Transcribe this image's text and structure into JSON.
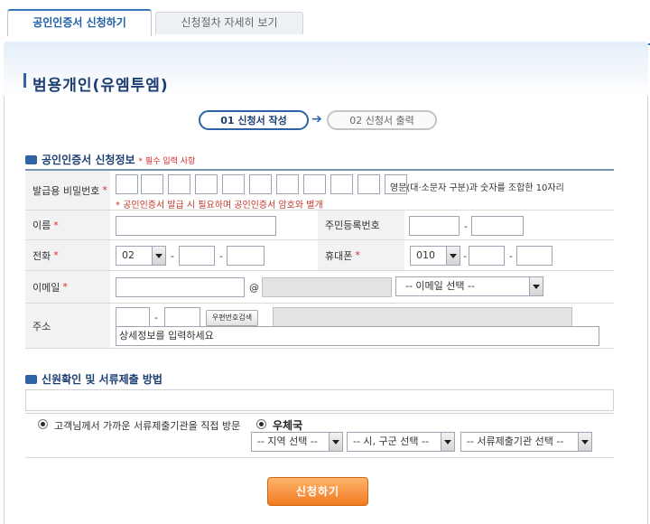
{
  "tabs": [
    {
      "label": "공인인증서 신청하기",
      "active": true
    },
    {
      "label": "신청절차 자세히 보기",
      "active": false
    }
  ],
  "page_title": "범용개인(유엠투엠)",
  "steps": [
    {
      "label": "01 신청서 작성",
      "active": true
    },
    {
      "label": "02 신청서 출력",
      "active": false
    }
  ],
  "section1": {
    "title": "공인인증서 신청정보",
    "required_note": "* 필수 입력 사항"
  },
  "form": {
    "password": {
      "label": "발급용 비밀번호",
      "hint": "영문(대·소문자 구분)과 숫자를 조합한 10자리",
      "warning": "* 공인인증서 발급 시 필요하며 공인인증서 암호와 별개"
    },
    "name": {
      "label": "이름",
      "value": ""
    },
    "resident_no": {
      "label": "주민등록번호"
    },
    "phone": {
      "label": "전화",
      "area_code": "02"
    },
    "mobile": {
      "label": "휴대폰",
      "prefix": "010"
    },
    "email": {
      "label": "이메일",
      "at": "@",
      "domain_select": "-- 이메일 선택 --"
    },
    "address": {
      "label": "주소",
      "zip_button": "우편번호검색",
      "detail_placeholder": "상세정보를 입력하세요"
    }
  },
  "section2": {
    "title": "신원확인 및 서류제출 방법",
    "option_visit": "고객님께서 가까운 서류제출기관을 직접 방문",
    "option_post": "우체국",
    "region_select": "-- 지역 선택 --",
    "district_select": "-- 시, 구군 선택 --",
    "agency_select": "-- 서류제출기관 선택 --"
  },
  "required_mark": "*",
  "dash": "-",
  "submit_label": "신청하기",
  "colors": {
    "accent": "#2e63a6",
    "required": "#d62a2a",
    "submit": "#f07a22"
  }
}
